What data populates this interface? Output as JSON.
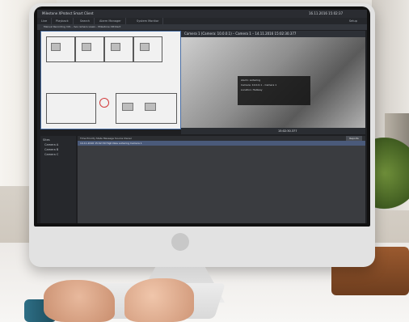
{
  "screen": {
    "app_title": "Milestone XProtect Smart Client",
    "clock": "16.11.2016 15:02:37",
    "tabs": [
      "Live",
      "Playback",
      "Search",
      "Alarm Manager",
      "System Monitor"
    ],
    "setup_label": "Setup",
    "toolbar_info": "Manual Recording Info – live camera views – Milestone XProtect",
    "camera_title": "Camera 1 (Camera: 10.0.0.1) – Camera 1 – 14.11.2016 15:02:30.377",
    "camera_info_lines": [
      "Alarm: Loitering",
      "Camera: 10.0.0.1 – Camera 1",
      "Location: Hallway"
    ],
    "timeline_time": "15:02:30.377",
    "left_panel_items": [
      "Sites",
      "Camera A",
      "Camera B",
      "Camera C"
    ],
    "grid_header": "Time   Priority  State  Message  Source  Owner",
    "grid_row": "14.11.2016 15:02:30   High   New   Loitering   Camera 1",
    "reports_label": "Reports"
  }
}
